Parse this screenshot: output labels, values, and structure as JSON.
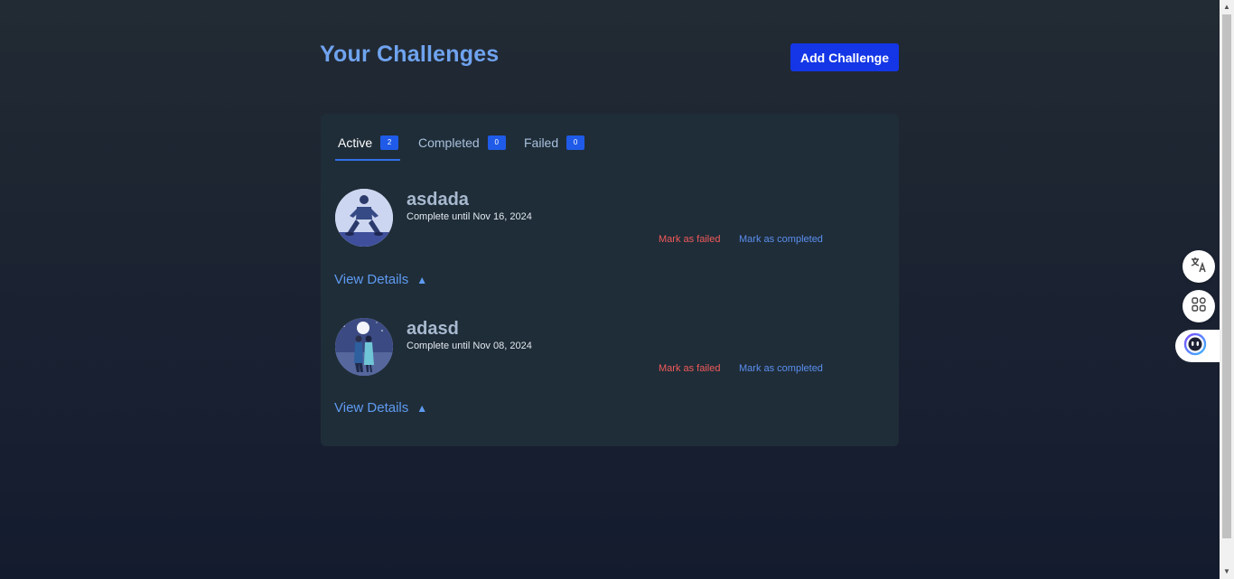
{
  "header": {
    "title": "Your Challenges",
    "add_button": "Add Challenge"
  },
  "tabs": [
    {
      "label": "Active",
      "count": "2",
      "active": true
    },
    {
      "label": "Completed",
      "count": "0",
      "active": false
    },
    {
      "label": "Failed",
      "count": "0",
      "active": false
    }
  ],
  "challenges": [
    {
      "name": "asdada",
      "date": "Complete until Nov 16, 2024",
      "mark_failed": "Mark as failed",
      "mark_completed": "Mark as completed",
      "view_details": "View Details",
      "avatar": "person-stretching-avatar"
    },
    {
      "name": "adasd",
      "date": "Complete until Nov 08, 2024",
      "mark_failed": "Mark as failed",
      "mark_completed": "Mark as completed",
      "view_details": "View Details",
      "avatar": "couple-night-avatar"
    }
  ],
  "floating": {
    "translate_icon": "translate-icon",
    "apps_icon": "apps-grid-icon",
    "assistant_icon": "assistant-face-icon"
  },
  "colors": {
    "title": "#6fa3ef",
    "primary_button": "#1436e6",
    "badge": "#1f5be8",
    "failed": "#f05a5a",
    "completed": "#5b8ff0",
    "card": "#1f2d38"
  }
}
